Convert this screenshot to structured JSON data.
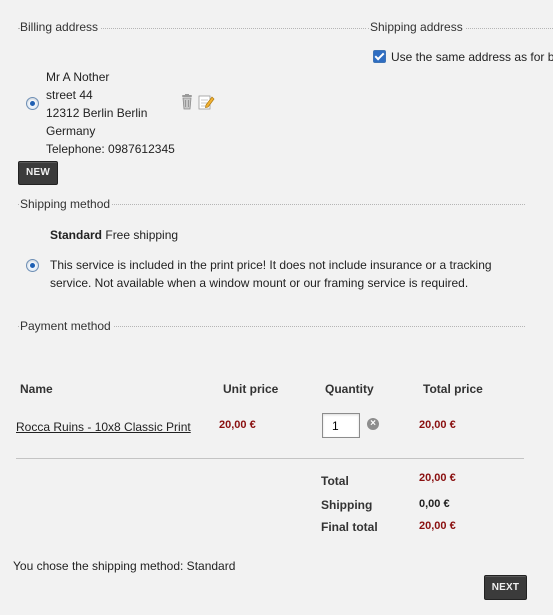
{
  "billing": {
    "title": "Billing address",
    "address_lines": [
      "Mr A Nother",
      "street 44",
      "12312 Berlin Berlin",
      "Germany",
      "Telephone: 0987612345"
    ],
    "new_button_label": "NEW"
  },
  "shipping_address": {
    "title": "Shipping address",
    "same_address_label": "Use the same address as for b",
    "same_address_checked": true
  },
  "shipping_method": {
    "title": "Shipping method",
    "name": "Standard",
    "name_suffix": "Free shipping",
    "description_line1": "This service is included in the print price! It does not include insurance or a tracking",
    "description_line2": "service. Not available when a window mount or our framing service is required."
  },
  "payment_method": {
    "title": "Payment method"
  },
  "cart": {
    "headers": {
      "name": "Name",
      "unit_price": "Unit price",
      "quantity": "Quantity",
      "total_price": "Total price"
    },
    "items": [
      {
        "name": "Rocca Ruins - 10x8 Classic Print",
        "unit_price": "20,00 €",
        "quantity": "1",
        "total_price": "20,00 €"
      }
    ],
    "totals": [
      {
        "label": "Total",
        "value": "20,00 €"
      },
      {
        "label": "Shipping",
        "value": "0,00 €"
      },
      {
        "label": "Final total",
        "value": "20,00 €"
      }
    ]
  },
  "footer": {
    "chosen_text": "You chose the shipping method: Standard",
    "next_button_label": "NEXT"
  },
  "colors": {
    "price": "#8a1010",
    "button_bg": "#3b3b3b",
    "background": "#f2f2f2"
  }
}
